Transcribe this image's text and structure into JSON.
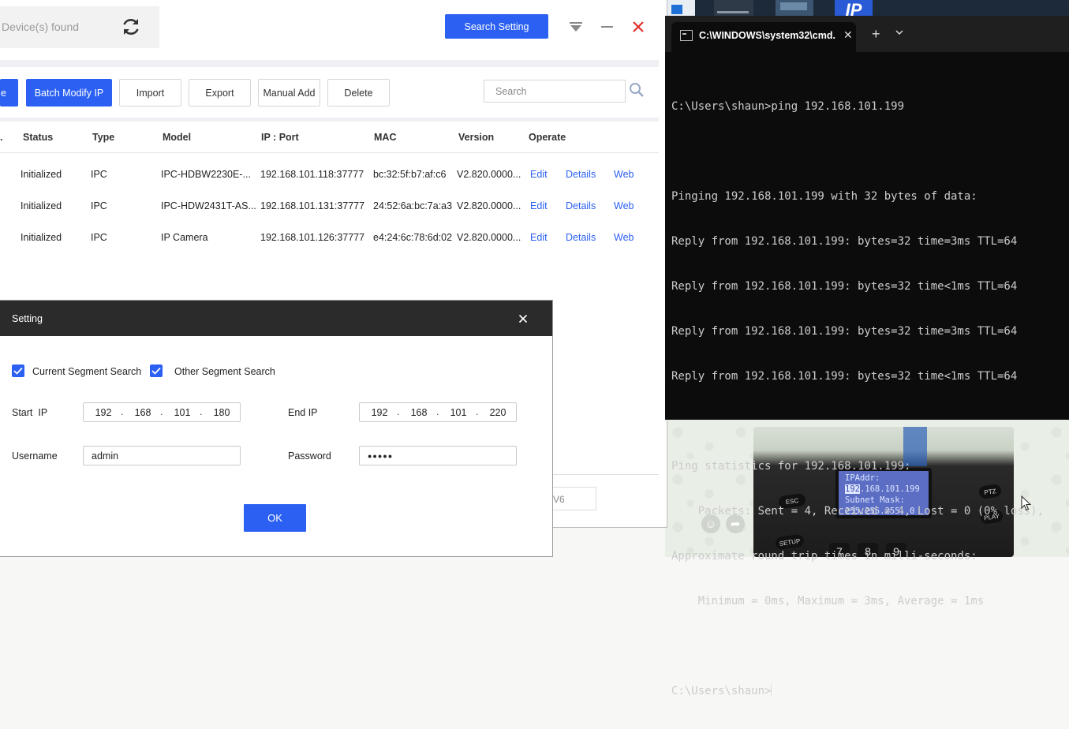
{
  "app": {
    "devices_found": "Device(s) found",
    "search_setting_label": "Search Setting",
    "toolbar": {
      "partial_left": "e",
      "batch_modify": "Batch Modify IP",
      "import": "Import",
      "export": "Export",
      "manual_add": "Manual Add",
      "delete": "Delete",
      "search_placeholder": "Search"
    },
    "table": {
      "headers": {
        "no": ".",
        "status": "Status",
        "type": "Type",
        "model": "Model",
        "ip_port": "IP : Port",
        "mac": "MAC",
        "version": "Version",
        "operate": "Operate"
      },
      "rows": [
        {
          "status": "Initialized",
          "type": "IPC",
          "model": "IPC-HDBW2230E-...",
          "ip_port": "192.168.101.118:37777",
          "mac": "bc:32:5f:b7:af:c6",
          "version": "V2.820.0000...",
          "edit": "Edit",
          "details": "Details",
          "web": "Web"
        },
        {
          "status": "Initialized",
          "type": "IPC",
          "model": "IPC-HDW2431T-AS...",
          "ip_port": "192.168.101.131:37777",
          "mac": "24:52:6a:bc:7a:a3",
          "version": "V2.820.0000...",
          "edit": "Edit",
          "details": "Details",
          "web": "Web"
        },
        {
          "status": "Initialized",
          "type": "IPC",
          "model": "IP Camera",
          "ip_port": "192.168.101.126:37777",
          "mac": "e4:24:6c:78:6d:02",
          "version": "V2.820.0000...",
          "edit": "Edit",
          "details": "Details",
          "web": "Web"
        }
      ]
    },
    "footer_partial": "V6"
  },
  "dialog": {
    "title": "Setting",
    "current_segment": "Current Segment Search",
    "other_segment": "Other Segment Search",
    "start_ip_label": "Start  IP",
    "start_ip": [
      "192",
      "168",
      "101",
      "180"
    ],
    "end_ip_label": "End IP",
    "end_ip": [
      "192",
      "168",
      "101",
      "220"
    ],
    "username_label": "Username",
    "username": "admin",
    "password_label": "Password",
    "password_mask": "●●●●●",
    "ok_label": "OK"
  },
  "terminal": {
    "tab_title": "C:\\WINDOWS\\system32\\cmd.",
    "lines": [
      "C:\\Users\\shaun>ping 192.168.101.199",
      "",
      "Pinging 192.168.101.199 with 32 bytes of data:",
      "Reply from 192.168.101.199: bytes=32 time=3ms TTL=64",
      "Reply from 192.168.101.199: bytes=32 time<1ms TTL=64",
      "Reply from 192.168.101.199: bytes=32 time=3ms TTL=64",
      "Reply from 192.168.101.199: bytes=32 time<1ms TTL=64",
      "",
      "Ping statistics for 192.168.101.199:",
      "    Packets: Sent = 4, Received = 4, Lost = 0 (0% loss),",
      "Approximate round trip times in milli-seconds:",
      "    Minimum = 0ms, Maximum = 3ms, Average = 1ms",
      ""
    ],
    "prompt": "C:\\Users\\shaun>"
  },
  "photo": {
    "lcd_line1": "IPAddr:",
    "lcd_line2_highlight": "192",
    "lcd_line2_rest": ".168.101.199",
    "lcd_line3": "Subnet Mask:",
    "lcd_line4": "255.255.255.  0",
    "key_esc": "ESC",
    "key_setup": "SETUP",
    "key_ptz": "PTZ",
    "key_play": "PLAY",
    "num_7": "7",
    "num_8": "8",
    "num_9": "9"
  },
  "desktop": {
    "ip_logo": "IP"
  },
  "colors": {
    "accent": "#2b60f2",
    "close_red": "#e0312e",
    "terminal_bg": "#0c0c0c"
  }
}
